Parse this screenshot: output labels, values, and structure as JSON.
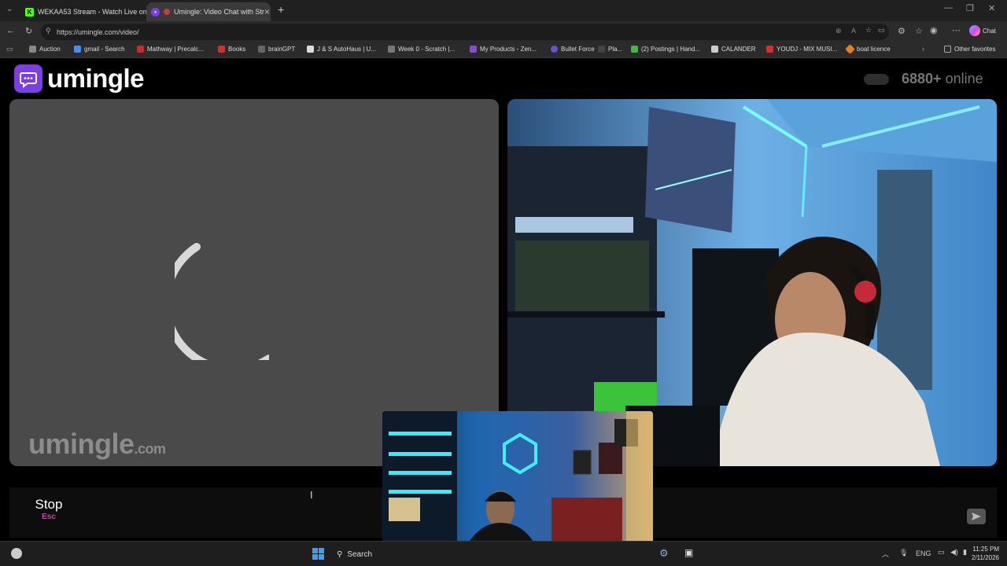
{
  "browser": {
    "tabs": [
      {
        "title": "WEKAA53 Stream - Watch Live on",
        "active": false,
        "favicon": "kick-icon"
      },
      {
        "title": "Umingle: Video Chat with Str",
        "active": true,
        "favicon": "umingle-icon"
      }
    ],
    "address": "https://umingle.com/video/",
    "chat_label": "Chat",
    "bookmarks": [
      {
        "label": "Auction",
        "color": "#888"
      },
      {
        "label": "gmail - Search",
        "color": "#4a8df0"
      },
      {
        "label": "Mathway | Precalc...",
        "color": "#c03030"
      },
      {
        "label": "Books",
        "color": "#d03030"
      },
      {
        "label": "brainGPT",
        "color": "#666"
      },
      {
        "label": "J & S AutoHaus | U...",
        "color": "#ddd"
      },
      {
        "label": "Week 0 - Scratch |...",
        "color": "#777"
      },
      {
        "label": "My Products - Zen...",
        "color": "#8a4ad8"
      },
      {
        "label": "Bullet Force",
        "color": "#7050d0"
      },
      {
        "label": "Pla...",
        "color": "#444"
      },
      {
        "label": "(2) Postings | Hand...",
        "color": "#4caf50"
      },
      {
        "label": "CALANDER",
        "color": "#ccc"
      },
      {
        "label": "YOUDJ - MIX MUSI...",
        "color": "#d03030"
      },
      {
        "label": "boat licence",
        "color": "#e08020"
      }
    ],
    "other_favorites": "Other favorites"
  },
  "site": {
    "brand": "umingle",
    "online_count": "6880+",
    "online_label": "online",
    "watermark_main": "umingle",
    "watermark_suffix": ".com",
    "stop_label": "Stop",
    "stop_key": "Esc",
    "chat_placeholder": ""
  },
  "taskbar": {
    "search_label": "Search",
    "language": "ENG",
    "time": "11:25 PM",
    "date": "2/11/2026"
  }
}
